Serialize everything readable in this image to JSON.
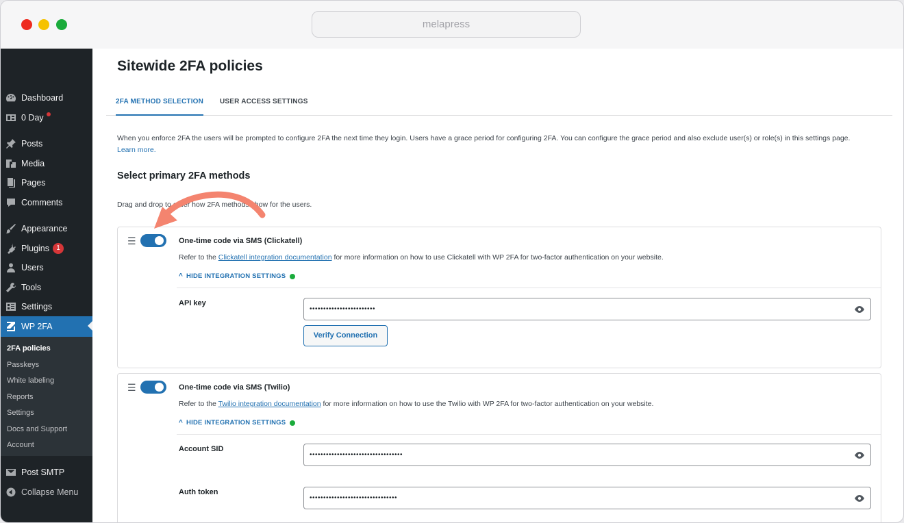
{
  "window": {
    "url_text": "melapress"
  },
  "sidebar": {
    "items": [
      {
        "label": "Dashboard",
        "icon": "dashboard-icon"
      },
      {
        "label": "0 Day",
        "icon": "day-icon",
        "dot": true
      },
      {
        "label": "Posts",
        "icon": "pin-icon"
      },
      {
        "label": "Media",
        "icon": "media-icon"
      },
      {
        "label": "Pages",
        "icon": "pages-icon"
      },
      {
        "label": "Comments",
        "icon": "comments-icon"
      },
      {
        "label": "Appearance",
        "icon": "brush-icon"
      },
      {
        "label": "Plugins",
        "icon": "plugin-icon",
        "badge": "1"
      },
      {
        "label": "Users",
        "icon": "user-icon"
      },
      {
        "label": "Tools",
        "icon": "wrench-icon"
      },
      {
        "label": "Settings",
        "icon": "settings-icon"
      },
      {
        "label": "WP 2FA",
        "icon": "wp2fa-icon",
        "active": true
      },
      {
        "label": "Post SMTP",
        "icon": "mail-icon"
      },
      {
        "label": "Collapse Menu",
        "icon": "collapse-icon"
      }
    ],
    "submenu": [
      "2FA policies",
      "Passkeys",
      "White labeling",
      "Reports",
      "Settings",
      "Docs and Support",
      "Account"
    ]
  },
  "page": {
    "title": "Sitewide 2FA policies",
    "tabs": [
      "2FA METHOD SELECTION",
      "USER ACCESS SETTINGS"
    ],
    "intro": "When you enforce 2FA the users will be prompted to configure 2FA the next time they login. Users have a grace period for configuring 2FA. You can configure the grace period and also exclude user(s) or role(s) in this settings page.",
    "learn_more": "Learn more.",
    "section_title": "Select primary 2FA methods",
    "drag_note": "Drag and drop to order how 2FA methods show for the users."
  },
  "methods": [
    {
      "title": "One-time code via SMS (Clickatell)",
      "desc_prefix": "Refer to the ",
      "desc_link": "Clickatell integration documentation",
      "desc_suffix": " for more information on how to use Clickatell with WP 2FA for two-factor authentication on your website.",
      "hide_label": "HIDE INTEGRATION SETTINGS",
      "enabled": true,
      "fields": [
        {
          "label": "API key",
          "value": "••••••••••••••••••••••••"
        }
      ],
      "verify_label": "Verify Connection"
    },
    {
      "title": "One-time code via SMS (Twilio)",
      "desc_prefix": "Refer to the ",
      "desc_link": "Twilio integration documentation",
      "desc_suffix": " for more information on how to use the Twilio with WP 2FA for two-factor authentication on your website.",
      "hide_label": "HIDE INTEGRATION SETTINGS",
      "enabled": true,
      "fields": [
        {
          "label": "Account SID",
          "value": "••••••••••••••••••••••••••••••••••"
        },
        {
          "label": "Auth token",
          "value": "••••••••••••••••••••••••••••••••"
        }
      ]
    }
  ],
  "colors": {
    "accent": "#2271b1",
    "sidebar": "#1e2327",
    "annotation_arrow": "#f4846f",
    "status_green": "#1aab3b"
  }
}
